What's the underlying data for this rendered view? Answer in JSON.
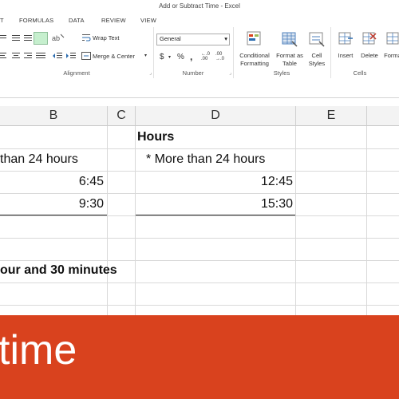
{
  "window": {
    "title": "Add or Subtract Time - Excel"
  },
  "tabs": [
    "T",
    "FORMULAS",
    "DATA",
    "REVIEW",
    "VIEW"
  ],
  "ribbon": {
    "alignment": {
      "label": "Alignment",
      "wrap_text": "Wrap Text",
      "merge_center": "Merge & Center"
    },
    "number": {
      "label": "Number",
      "format": "General",
      "currency": "$",
      "percent": "%",
      "comma": ",",
      "inc_decimal": "←.0 .00",
      "dec_decimal": ".00 →.0"
    },
    "styles": {
      "label": "Styles",
      "conditional_1": "Conditional",
      "conditional_2": "Formatting",
      "format_as_1": "Format as",
      "format_as_2": "Table",
      "cell_styles_1": "Cell",
      "cell_styles_2": "Styles"
    },
    "cells": {
      "label": "Cells",
      "insert": "Insert",
      "delete": "Delete",
      "format": "Format"
    }
  },
  "columns": [
    "B",
    "C",
    "D",
    "E"
  ],
  "cells": {
    "b1": "than 24 hours",
    "b2": "6:45",
    "b3": "9:30",
    "b6": "our and 30 minutes",
    "d0": "Hours",
    "d1": "* More than 24 hours",
    "d2": "12:45",
    "d3": "15:30"
  },
  "banner": {
    "text": "time"
  },
  "colors": {
    "banner": "#d9421e",
    "header_bg": "#f3f3f3",
    "accent": "#217346"
  }
}
